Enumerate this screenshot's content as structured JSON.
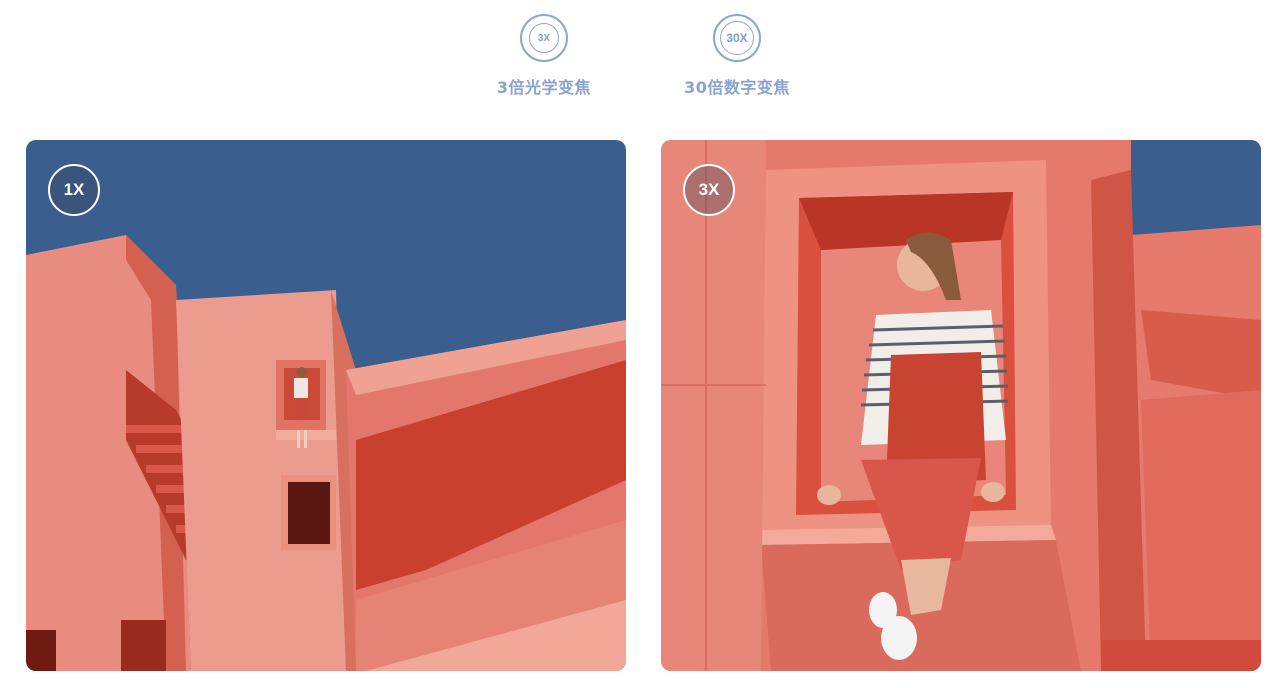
{
  "features": [
    {
      "icon_text": "3X",
      "label": "3倍光学变焦",
      "icon": "zoom-3x-icon"
    },
    {
      "icon_text": "30X",
      "label": "30倍数字变焦",
      "icon": "zoom-30x-icon"
    }
  ],
  "photos": [
    {
      "badge": "1X",
      "description_icon": "wide-angle-photo"
    },
    {
      "badge": "3X",
      "description_icon": "zoomed-photo"
    }
  ],
  "colors": {
    "accent": "#8ba6cf",
    "sky": "#3a5e8e",
    "wall": "#e4776c",
    "wall_shadow": "#c9402e"
  }
}
